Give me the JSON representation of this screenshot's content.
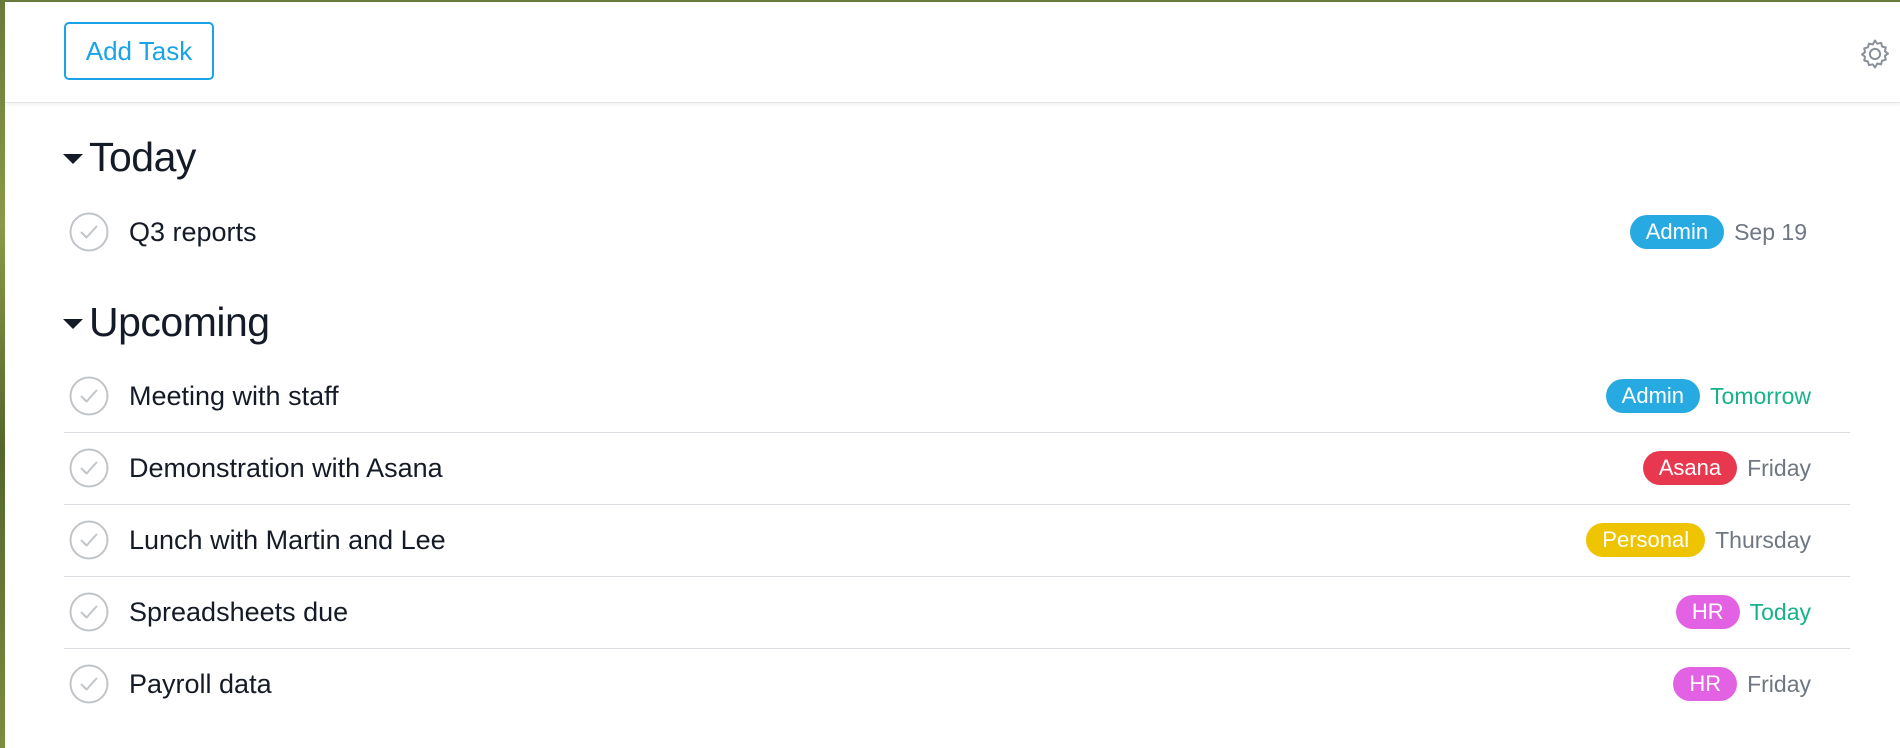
{
  "toolbar": {
    "add_task_label": "Add Task",
    "settings_icon": "gear-icon"
  },
  "colors": {
    "accent": "#1aa4e8",
    "admin": "#27a9e1",
    "asana": "#e8384f",
    "personal": "#eec300",
    "hr": "#e362e3",
    "due_soon": "#16b38a",
    "due_normal": "#6f7782"
  },
  "sections": [
    {
      "title": "Today",
      "tasks": [
        {
          "name": "Q3 reports",
          "tag": "Admin",
          "due": "Sep 19"
        }
      ]
    },
    {
      "title": "Upcoming",
      "tasks": [
        {
          "name": "Meeting with staff",
          "tag": "Admin",
          "due": "Tomorrow"
        },
        {
          "name": "Demonstration with Asana",
          "tag": "Asana",
          "due": "Friday"
        },
        {
          "name": "Lunch with Martin and Lee",
          "tag": "Personal",
          "due": "Thursday"
        },
        {
          "name": "Spreadsheets due",
          "tag": "HR",
          "due": "Today"
        },
        {
          "name": "Payroll data",
          "tag": "HR",
          "due": "Friday"
        }
      ]
    }
  ]
}
